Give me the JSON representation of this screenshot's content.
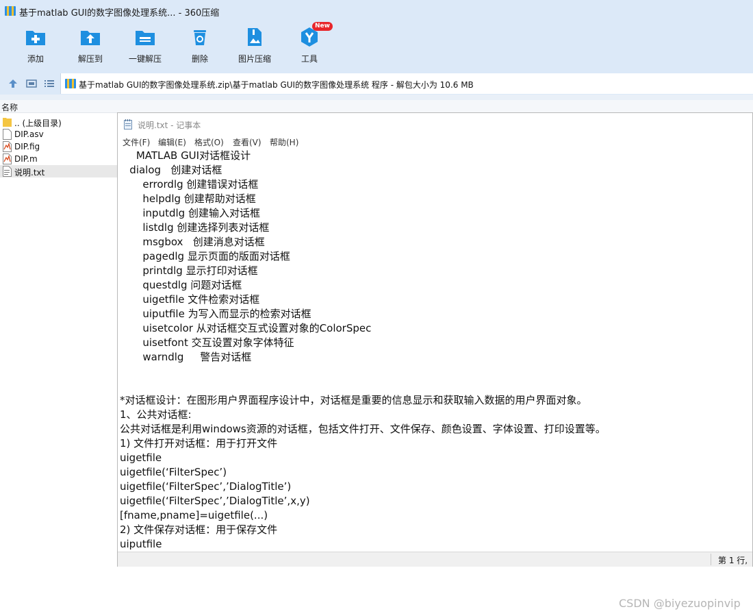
{
  "colors": {
    "chrome_bg": "#dce9f8",
    "accent_blue": "#1e8fe0",
    "badge_red": "#e8262b"
  },
  "window": {
    "title": "基于matlab GUI的数字图像处理系统... - 360压缩",
    "icon": "archive-icon"
  },
  "toolbar": {
    "buttons": [
      {
        "label": "添加",
        "icon": "add-folder-icon"
      },
      {
        "label": "解压到",
        "icon": "extract-to-icon"
      },
      {
        "label": "一键解压",
        "icon": "one-click-extract-icon"
      },
      {
        "label": "删除",
        "icon": "trash-icon"
      },
      {
        "label": "图片压缩",
        "icon": "image-compress-icon"
      },
      {
        "label": "工具",
        "icon": "tools-icon"
      }
    ],
    "new_badge": "New"
  },
  "address": {
    "path": "基于matlab GUI的数字图像处理系统.zip\\基于matlab GUI的数字图像处理系统  程序 - 解包大小为 10.6 MB"
  },
  "file_list": {
    "column_name": "名称",
    "items": [
      {
        "name": ".. (上级目录)",
        "icon": "folder-icon"
      },
      {
        "name": "DIP.asv",
        "icon": "file-icon"
      },
      {
        "name": "DIP.fig",
        "icon": "matlab-fig-icon"
      },
      {
        "name": "DIP.m",
        "icon": "matlab-file-icon"
      },
      {
        "name": "说明.txt",
        "icon": "text-file-icon"
      }
    ],
    "selected": "说明.txt"
  },
  "notepad": {
    "title": "说明.txt - 记事本",
    "menu": [
      "文件(F)",
      "编辑(E)",
      "格式(O)",
      "查看(V)",
      "帮助(H)"
    ],
    "lines": [
      "     MATLAB GUI对话框设计",
      "   dialog   创建对话框",
      "       errordlg 创建错误对话框",
      "       helpdlg 创建帮助对话框",
      "       inputdlg 创建输入对话框",
      "       listdlg 创建选择列表对话框",
      "       msgbox   创建消息对话框",
      "       pagedlg 显示页面的版面对话框",
      "       printdlg 显示打印对话框",
      "       questdlg 问题对话框",
      "       uigetfile 文件检索对话框",
      "       uiputfile 为写入而显示的检索对话框",
      "       uisetcolor 从对话框交互式设置对象的ColorSpec",
      "       uisetfont 交互设置对象字体特征",
      "       warndlg     警告对话框",
      "",
      "",
      "*对话框设计：在图形用户界面程序设计中，对话框是重要的信息显示和获取输入数据的用户界面对象。",
      "1、公共对话框:",
      "公共对话框是利用windows资源的对话框，包括文件打开、文件保存、颜色设置、字体设置、打印设置等。",
      "1) 文件打开对话框：用于打开文件",
      "uigetfile",
      "uigetfile(‘FilterSpec’)",
      "uigetfile(‘FilterSpec’,’DialogTitle’)",
      "uigetfile(‘FilterSpec’,’DialogTitle’,x,y)",
      "[fname,pname]=uigetfile(...)",
      "2) 文件保存对话框：用于保存文件",
      "uiputfile"
    ],
    "status_position": "第 1 行,"
  },
  "watermark": "CSDN @biyezuopinvip"
}
